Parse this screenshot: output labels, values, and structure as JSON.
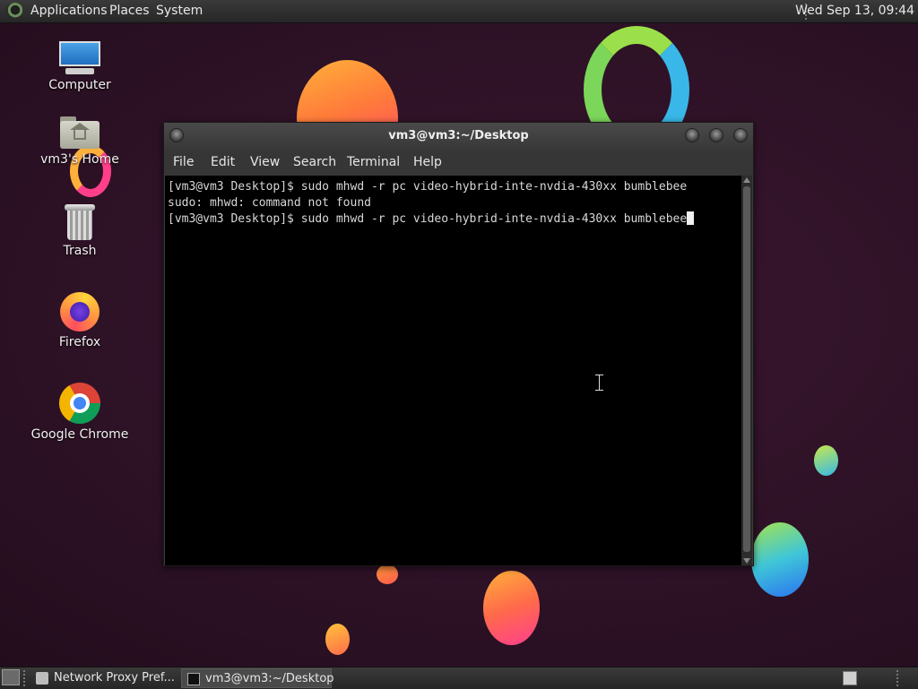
{
  "top_panel": {
    "menus": [
      "Applications",
      "Places",
      "System"
    ],
    "clock": "Wed Sep 13, 09:44"
  },
  "desktop_icons": [
    {
      "label": "Computer",
      "icon": "computer-icon"
    },
    {
      "label": "vm3's Home",
      "icon": "home-folder-icon"
    },
    {
      "label": "Trash",
      "icon": "trash-icon"
    },
    {
      "label": "Firefox",
      "icon": "firefox-icon"
    },
    {
      "label": "Google Chrome",
      "icon": "chrome-icon"
    }
  ],
  "terminal": {
    "title": "vm3@vm3:~/Desktop",
    "menu": [
      "File",
      "Edit",
      "View",
      "Search",
      "Terminal",
      "Help"
    ],
    "lines": [
      "[vm3@vm3 Desktop]$ sudo mhwd -r pc video-hybrid-inte-nvdia-430xx bumblebee",
      "sudo: mhwd: command not found",
      "[vm3@vm3 Desktop]$ sudo mhwd -r pc video-hybrid-inte-nvdia-430xx bumblebee"
    ]
  },
  "taskbar": {
    "tasks": [
      {
        "label": "Network Proxy Pref...",
        "icon": "network-proxy-icon"
      },
      {
        "label": "vm3@vm3:~/Desktop",
        "icon": "terminal-icon"
      }
    ]
  }
}
